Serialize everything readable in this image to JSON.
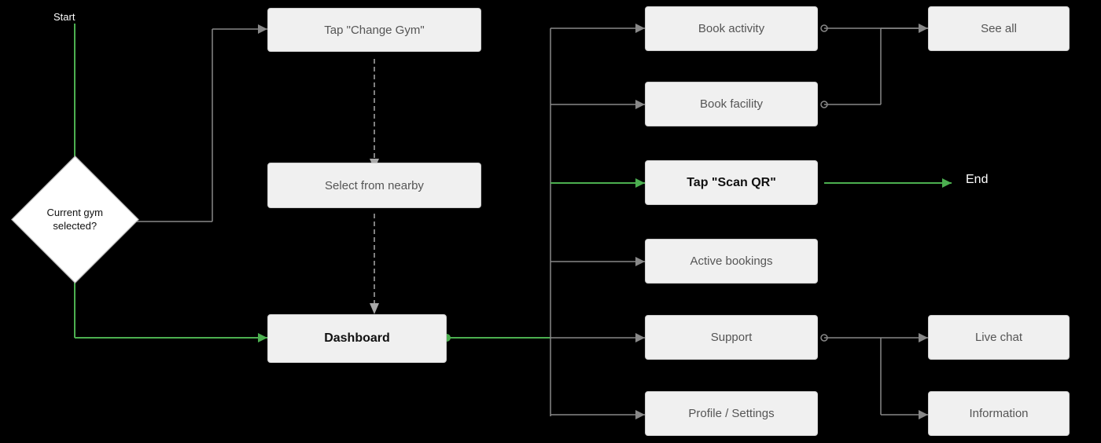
{
  "nodes": {
    "start_label": "Start",
    "end_label": "End",
    "diamond": "Current gym\nselected?",
    "change_gym": "Tap \"Change Gym\"",
    "select_nearby": "Select from nearby",
    "dashboard": "Dashboard",
    "book_activity": "Book activity",
    "book_facility": "Book facility",
    "scan_qr": "Tap \"Scan QR\"",
    "active_bookings": "Active bookings",
    "support": "Support",
    "live_chat": "Live chat",
    "profile_settings": "Profile / Settings",
    "information": "Information",
    "see_all": "See all"
  },
  "colors": {
    "green": "#4caf50",
    "gray_line": "#888",
    "dashed_line": "#aaa",
    "node_bg": "#f0f0f0",
    "node_border": "#ccc",
    "background": "#000"
  }
}
